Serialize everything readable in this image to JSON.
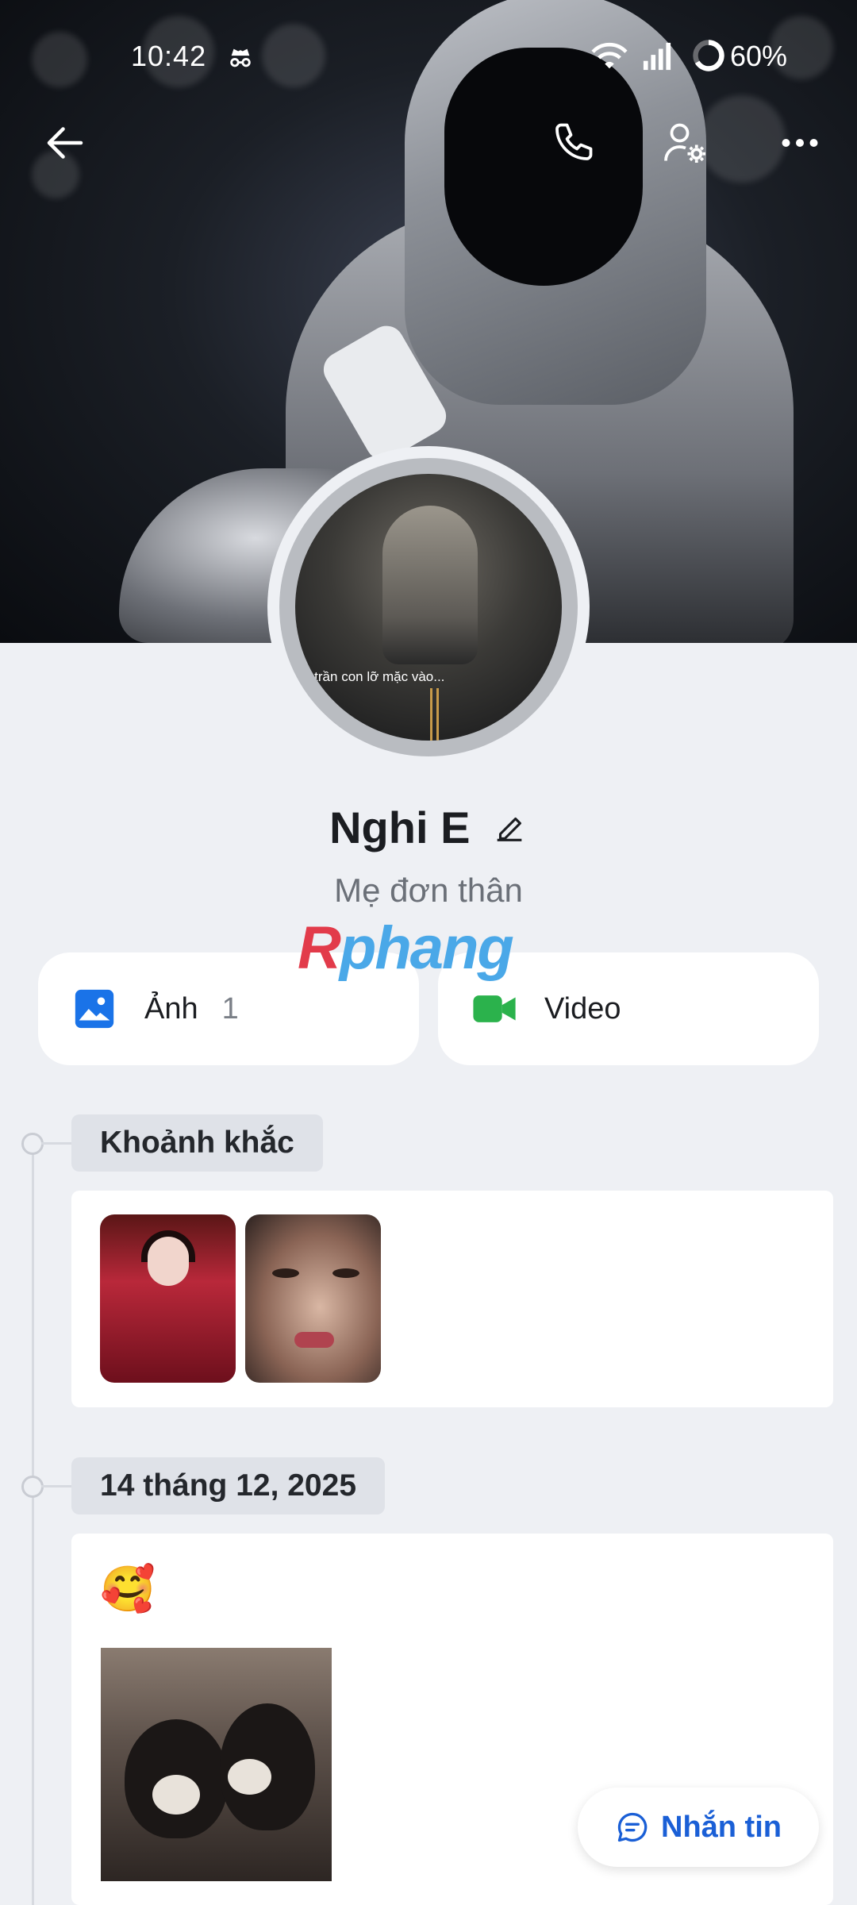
{
  "status_bar": {
    "time": "10:42",
    "battery": "60%"
  },
  "icons": {
    "back": "back-arrow-icon",
    "call": "phone-icon",
    "profile_settings": "user-gear-icon",
    "more": "more-dots-icon",
    "edit": "pencil-icon",
    "photos": "image-icon",
    "videos": "video-camera-icon",
    "message": "chat-bubble-icon"
  },
  "profile": {
    "avatar_caption": "o trần con lỡ mặc vào...",
    "name": "Nghi E",
    "bio": "Mẹ đơn thân"
  },
  "watermark": {
    "first": "R",
    "rest": "phang"
  },
  "media": {
    "photos_label": "Ảnh",
    "photos_count": "1",
    "videos_label": "Video"
  },
  "timeline": [
    {
      "label": "Khoảnh khắc"
    },
    {
      "label": "14 tháng 12, 2025",
      "text": "🥰"
    }
  ],
  "actions": {
    "message_label": "Nhắn tin"
  },
  "colors": {
    "accent": "#1a5fd6",
    "photo_icon": "#1a73e8",
    "video_icon": "#2bb24c",
    "background": "#eef0f4"
  }
}
